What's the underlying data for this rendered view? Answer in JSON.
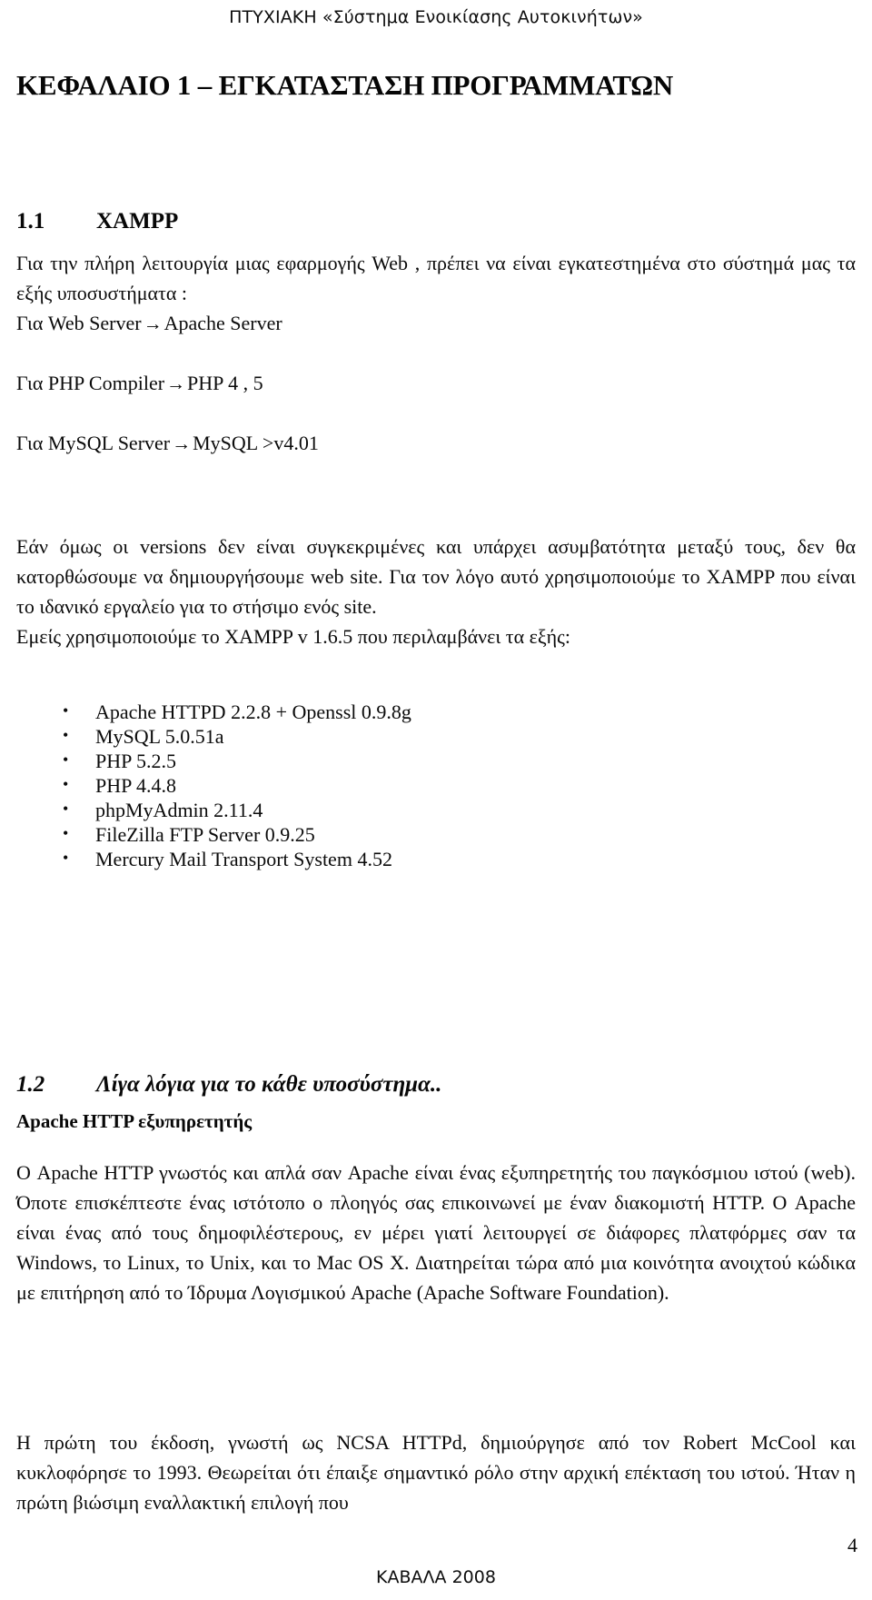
{
  "header": {
    "running_title": "ΠΤΥΧΙΑΚΗ «Σύστημα Ενοικίασης Αυτοκινήτων»"
  },
  "chapter": {
    "title": "ΚΕΦΑΛΑΙΟ 1 – ΕΓΚΑΤΑΣΤΑΣΗ  ΠΡΟΓΡΑΜΜΑΤΩΝ"
  },
  "section_1_1": {
    "number": "1.1",
    "title": "XAMPP",
    "intro": "Για την πλήρη λειτουργία μιας εφαρμογής Web , πρέπει να είναι εγκατεστημένα στο σύστημά μας  τα εξής  υποσυστήματα :",
    "req_web_label": "Για Web Server",
    "req_web_value": "Apache Server",
    "req_php_label": "Για PHP Compiler",
    "req_php_value": "PHP 4 , 5",
    "req_mysql_label": "Για MySQL Server",
    "req_mysql_value": "MySQL >v4.01",
    "arrow_glyph": "→",
    "para_versions": "Εάν όμως οι versions δεν είναι συγκεκριμένες και υπάρχει ασυμβατότητα μεταξύ τους, δεν θα κατορθώσουμε να δημιουργήσουμε web site.   Για τον λόγο αυτό χρησιμοποιούμε το XAMPP που είναι το ιδανικό εργαλείο για το στήσιμο ενός site.",
    "para_version_used": "Εμείς χρησιμοποιούμε το XAMPP v 1.6.5 που περιλαμβάνει τα εξής:",
    "components": [
      "Apache HTTPD 2.2.8 + Openssl 0.9.8g",
      "MySQL 5.0.51a",
      "PHP 5.2.5",
      "PHP 4.4.8",
      "phpMyAdmin 2.11.4",
      "FileZilla FTP Server 0.9.25",
      "Mercury Mail Transport System 4.52"
    ]
  },
  "section_1_2": {
    "number": "1.2",
    "title": "Λίγα λόγια για το κάθε υποσύστημα..",
    "subheading": "Apache HTTP εξυπηρετητής",
    "para_apache_1": "Ο Apache HTTP γνωστός και απλά σαν Apache είναι ένας εξυπηρετητής του παγκόσμιου ιστού (web). Όποτε επισκέπτεστε ένας ιστότοπο ο πλοηγός σας επικοινωνεί με έναν διακομιστή HTTP. Ο Apache είναι ένας από τους δημοφιλέστερους, εν μέρει γιατί λειτουργεί σε διάφορες πλατφόρμες σαν τα Windows, το Linux, το Unix, και το Mac OS X. Διατηρείται τώρα από μια κοινότητα ανοιχτού κώδικα με επιτήρηση από το Ίδρυμα Λογισμικού Apache (Apache Software Foundation).",
    "para_apache_2": "Η πρώτη του έκδοση, γνωστή ως NCSA HTTPd, δημιούργησε από τον Robert McCool και κυκλοφόρησε το 1993. Θεωρείται ότι έπαιξε σημαντικό ρόλο στην αρχική επέκταση του ιστού. Ήταν η πρώτη βιώσιμη εναλλακτική επιλογή που"
  },
  "footer": {
    "page_number": "4",
    "place_year": "ΚΑΒΑΛΑ 2008"
  }
}
